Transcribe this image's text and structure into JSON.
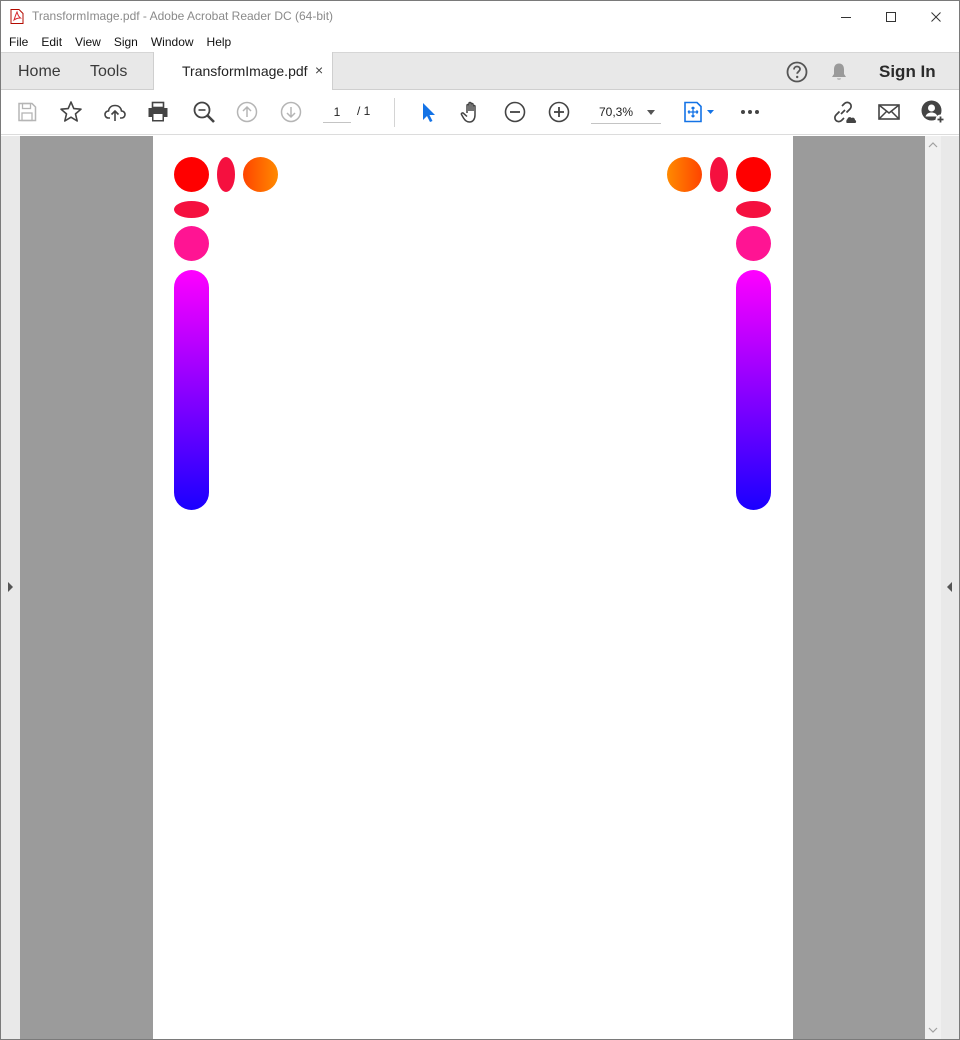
{
  "window": {
    "title": "TransformImage.pdf - Adobe Acrobat Reader DC (64-bit)"
  },
  "menu": {
    "items": [
      {
        "label": "File"
      },
      {
        "label": "Edit"
      },
      {
        "label": "View"
      },
      {
        "label": "Sign"
      },
      {
        "label": "Window"
      },
      {
        "label": "Help"
      }
    ]
  },
  "tabs": {
    "home": "Home",
    "tools": "Tools",
    "document": "TransformImage.pdf",
    "close_glyph": "×",
    "sign_in": "Sign In"
  },
  "toolbar": {
    "page_current": "1",
    "page_total": "/ 1",
    "zoom": "70,3%",
    "icons": [
      "save-icon",
      "bookmark-star-icon",
      "upload-cloud-icon",
      "print-icon",
      "zoom-search-icon",
      "previous-page-icon",
      "next-page-icon",
      "select-cursor-icon",
      "hand-tool-icon",
      "zoom-out-icon",
      "zoom-in-icon",
      "fit-page-icon",
      "more-icon",
      "share-link-icon",
      "email-icon",
      "add-user-icon"
    ]
  },
  "colors": {
    "red": "#ff0000",
    "orange": "#ff7a00",
    "crimson": "#f5103f",
    "pink": "#ff1493",
    "magenta": "#ff00ff",
    "blue": "#1a00ff",
    "accent_blue": "#1473e6"
  }
}
